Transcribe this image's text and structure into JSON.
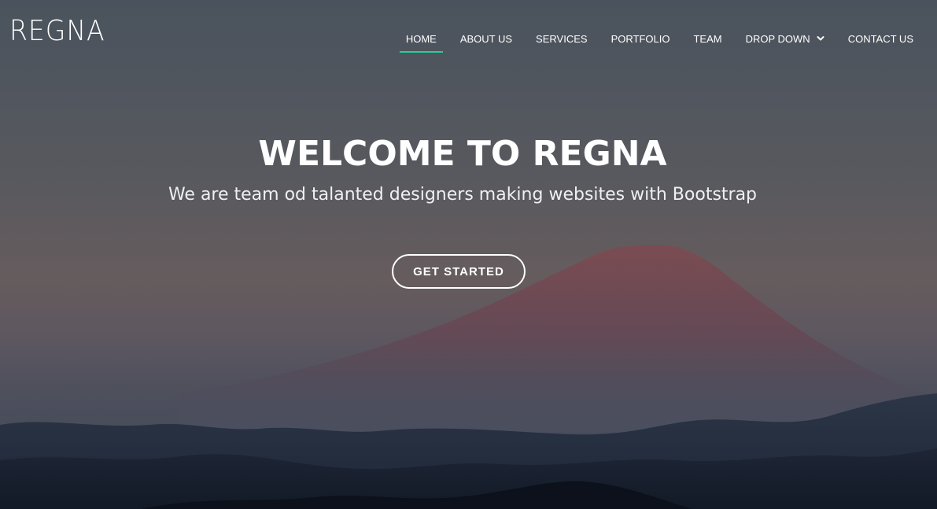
{
  "header": {
    "logo": "REGNA",
    "nav": [
      {
        "label": "HOME",
        "active": true
      },
      {
        "label": "ABOUT US",
        "active": false
      },
      {
        "label": "SERVICES",
        "active": false
      },
      {
        "label": "PORTFOLIO",
        "active": false
      },
      {
        "label": "TEAM",
        "active": false
      },
      {
        "label": "DROP DOWN",
        "active": false,
        "icon": "chevron-down-icon"
      },
      {
        "label": "CONTACT US",
        "active": false
      }
    ]
  },
  "hero": {
    "title": "WELCOME TO REGNA",
    "subtitle": "We are team od talanted designers making websites with Bootstrap",
    "cta_label": "GET STARTED"
  },
  "colors": {
    "accent": "#2dc997",
    "text": "#ffffff",
    "sky_top": "#4b5560",
    "sky_mid": "#5f5a5d",
    "mountain": "#5b4b55",
    "valley": "#1c2535"
  }
}
